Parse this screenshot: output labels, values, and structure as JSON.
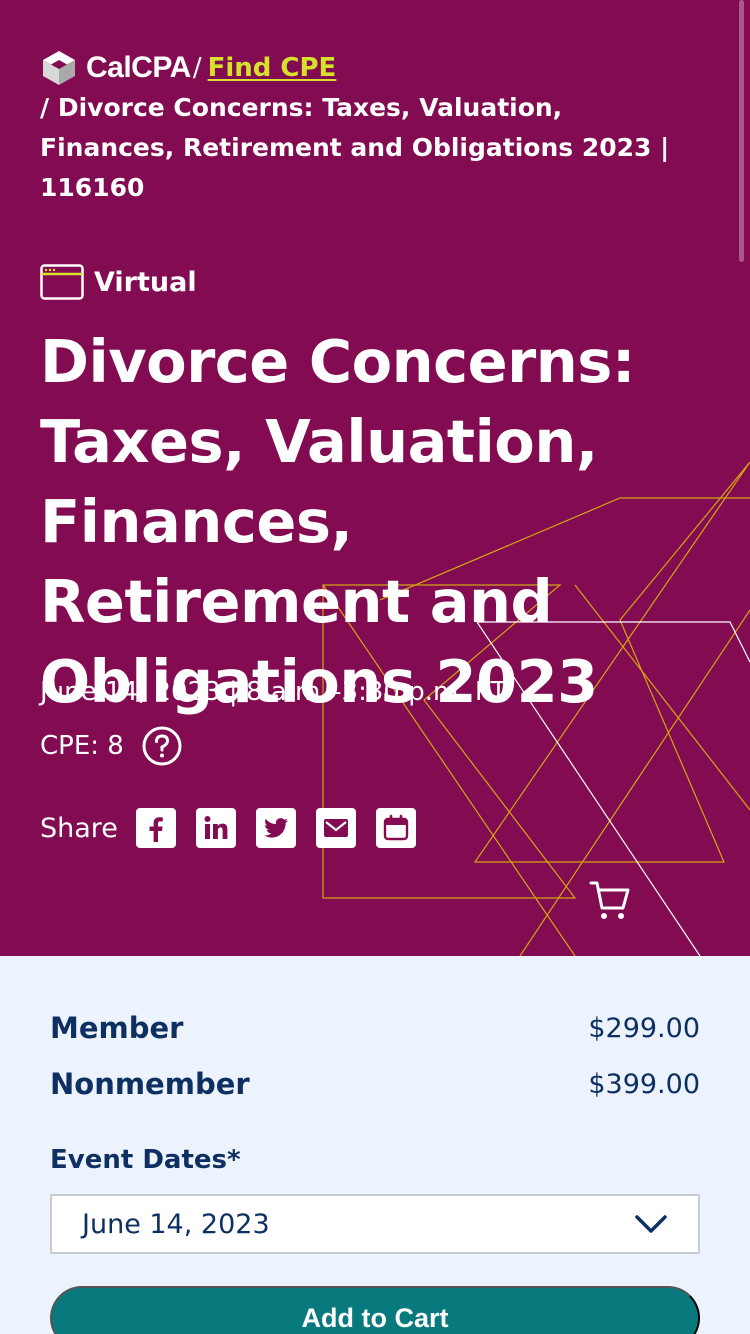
{
  "header": {
    "logo_text": "CalCPA",
    "separator": "/",
    "link_label": "Find CPE",
    "current_page": "/ Divorce Concerns: Taxes, Valuation, Finances, Retirement and Obligations 2023 | 116160"
  },
  "event": {
    "format": "Virtual",
    "title": "Divorce Concerns: Taxes, Valuation, Finances, Retirement and Obligations 2023",
    "datetime": "June 14, 2023 | 8 a.m.–3:30 p.m. PT",
    "cpe": "CPE: 8",
    "share_label": "Share",
    "share_icons": [
      "facebook-icon",
      "linkedin-icon",
      "twitter-icon",
      "email-icon",
      "calendar-icon"
    ]
  },
  "pricing": [
    {
      "label": "Member",
      "value": "$299.00"
    },
    {
      "label": "Nonmember",
      "value": "$399.00"
    }
  ],
  "form": {
    "dates_label": "Event Dates*",
    "selected_date": "June 14, 2023",
    "submit_label": "Add to Cart"
  },
  "colors": {
    "hero": "#820b51",
    "accent_link": "#d5e12b",
    "text_navy": "#0e2f62",
    "button": "#087a7d",
    "panel": "#ecf3fd"
  }
}
